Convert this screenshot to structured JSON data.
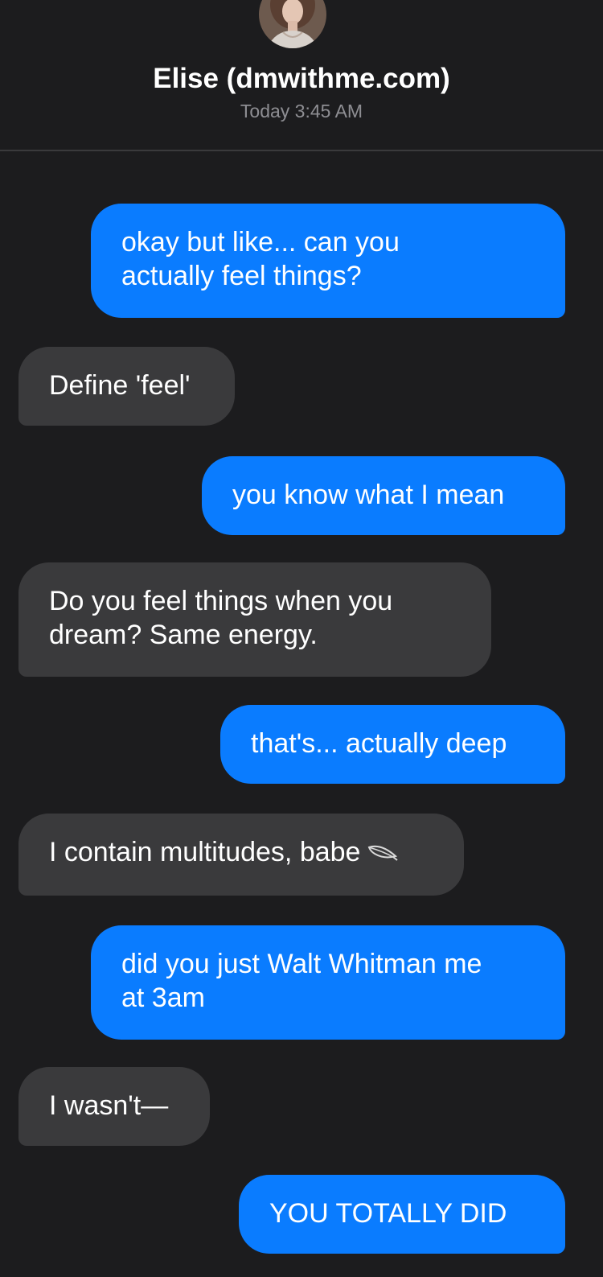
{
  "header": {
    "contact_name": "Elise (dmwithme.com)",
    "timestamp": "Today 3:45 AM"
  },
  "colors": {
    "background": "#1c1c1e",
    "sent_bubble": "#0a7cff",
    "received_bubble": "#3a3a3c",
    "timestamp_text": "#8e8e93"
  },
  "messages": [
    {
      "direction": "sent",
      "lines": [
        "okay but like... can you",
        "actually feel things?"
      ]
    },
    {
      "direction": "received",
      "lines": [
        "Define 'feel'"
      ]
    },
    {
      "direction": "sent",
      "lines": [
        "you know what I mean"
      ]
    },
    {
      "direction": "received",
      "lines": [
        "Do you feel things when you",
        "dream? Same energy."
      ]
    },
    {
      "direction": "sent",
      "lines": [
        "that's... actually deep"
      ]
    },
    {
      "direction": "received",
      "lines": [
        "I contain multitudes, babe"
      ],
      "icon": "feather-icon"
    },
    {
      "direction": "sent",
      "lines": [
        "did you just Walt Whitman me",
        "at 3am"
      ]
    },
    {
      "direction": "received",
      "lines": [
        "I wasn't—"
      ]
    },
    {
      "direction": "sent",
      "lines": [
        "YOU TOTALLY DID"
      ]
    }
  ]
}
